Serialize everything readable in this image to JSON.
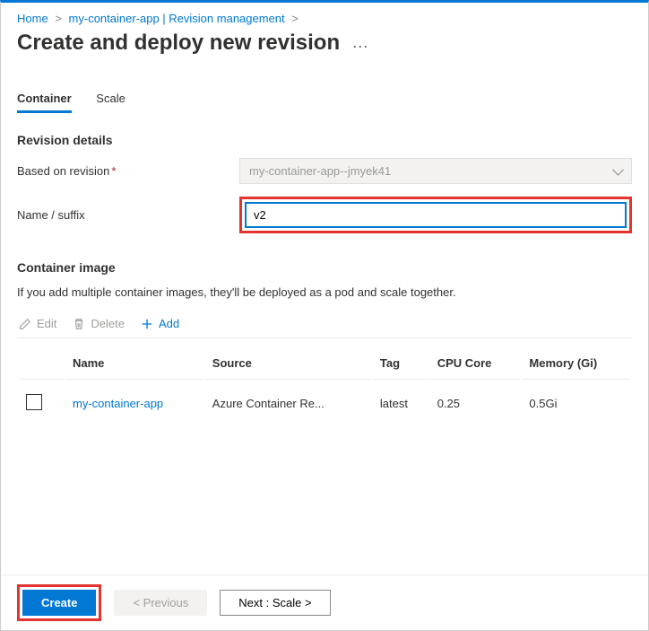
{
  "breadcrumb": {
    "home": "Home",
    "app": "my-container-app | Revision management"
  },
  "page_title": "Create and deploy new revision",
  "ellipsis": "···",
  "tabs": {
    "container": "Container",
    "scale": "Scale"
  },
  "revision_details": {
    "heading": "Revision details",
    "based_on_label": "Based on revision",
    "based_on_value": "my-container-app--jmyek41",
    "suffix_label": "Name / suffix",
    "suffix_value": "v2"
  },
  "container_image": {
    "heading": "Container image",
    "note": "If you add multiple container images, they'll be deployed as a pod and scale together."
  },
  "toolbar": {
    "edit": "Edit",
    "delete": "Delete",
    "add": "Add"
  },
  "table": {
    "headers": {
      "name": "Name",
      "source": "Source",
      "tag": "Tag",
      "cpu": "CPU Core",
      "memory": "Memory (Gi)"
    },
    "rows": [
      {
        "name": "my-container-app",
        "source": "Azure Container Re...",
        "tag": "latest",
        "cpu": "0.25",
        "memory": "0.5Gi"
      }
    ]
  },
  "footer": {
    "create": "Create",
    "previous": "< Previous",
    "next": "Next : Scale >"
  }
}
